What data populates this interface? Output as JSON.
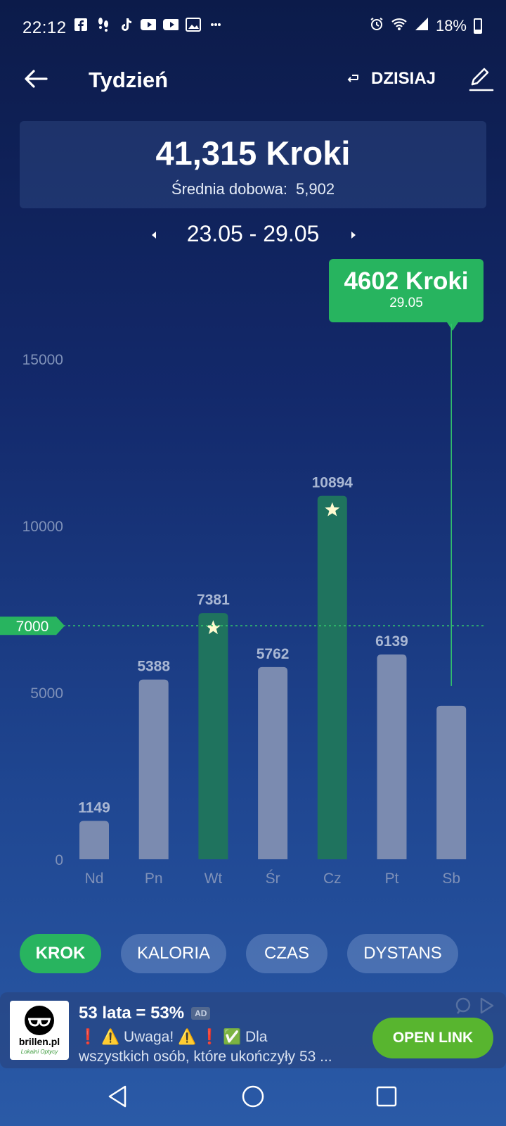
{
  "status": {
    "time": "22:12",
    "battery": "18%",
    "left_icons": [
      "facebook-icon",
      "footsteps-icon",
      "tiktok-icon",
      "youtube-icon",
      "youtube-icon",
      "gallery-icon",
      "more-icon"
    ]
  },
  "header": {
    "title": "Tydzień",
    "today_label": "DZISIAJ"
  },
  "summary": {
    "total": "41,315 Kroki",
    "avg_label": "Średnia dobowa:",
    "avg_value": "5,902"
  },
  "range": {
    "label": "23.05 - 29.05"
  },
  "tooltip": {
    "steps": "4602 Kroki",
    "date": "29.05"
  },
  "chart_data": {
    "type": "bar",
    "categories": [
      "Nd",
      "Pn",
      "Wt",
      "Śr",
      "Cz",
      "Pt",
      "Sb"
    ],
    "values": [
      1149,
      5388,
      7381,
      5762,
      10894,
      6139,
      4602
    ],
    "labels": [
      "1149",
      "5388",
      "7381",
      "5762",
      "10894",
      "6139",
      ""
    ],
    "goal_met": [
      false,
      false,
      true,
      false,
      true,
      false,
      false
    ],
    "goal": 7000,
    "goal_label": "7000",
    "yticks": [
      0,
      5000,
      10000,
      15000
    ],
    "ytick_labels": [
      "0",
      "5000",
      "10000",
      "15000"
    ],
    "ylim": [
      0,
      15000
    ],
    "selected_index": 6,
    "colors": {
      "bar": "#7b8bb0",
      "goal_bar": "#1f735e",
      "goal_line": "#33c56b",
      "axis_text": "#7f91b8"
    }
  },
  "tabs": [
    "KROK",
    "KALORIA",
    "CZAS",
    "DYSTANS"
  ],
  "active_tab": 0,
  "ad": {
    "logo_text": "brillen.pl",
    "logo_sub": "Lokalni Optycy",
    "title": "53 lata = 53%",
    "badge": "AD",
    "line1": "❗ ⚠️ Uwaga! ⚠️ ❗ ✅ Dla",
    "line2": "wszystkich osób, które ukończyły 53 ...",
    "button": "OPEN LINK"
  }
}
